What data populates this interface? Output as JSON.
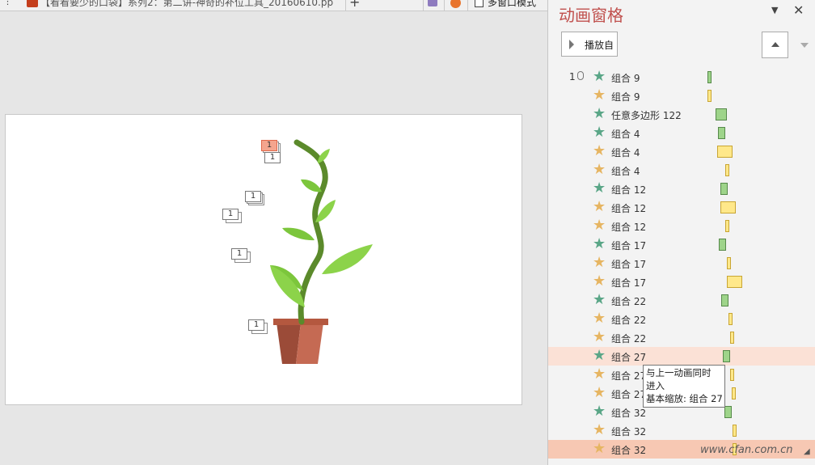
{
  "top_bar": {
    "overflow": "⋮",
    "document_tab": "【看看要少的口袋】系列2：第二讲-神奇的补位工具_20160610.pp",
    "new_tab": "+",
    "multiwindow_label": "多窗口模式"
  },
  "slide": {
    "tags": [
      "1",
      "1",
      "1",
      "1",
      "1",
      "1"
    ]
  },
  "pane": {
    "title": "动画窗格",
    "menu_glyph": "▼",
    "close_glyph": "✕",
    "play_label": "播放自",
    "colors": {
      "title": "#c0504d",
      "entrance_star": "#5aa687",
      "emphasis_star": "#e6b562",
      "green_bar": "#9ed48a",
      "yellow_bar": "#ffe88a"
    },
    "rows": [
      {
        "index": "1",
        "star": "green",
        "name": "组合 9",
        "bar": "green"
      },
      {
        "index": "",
        "star": "yellow",
        "name": "组合 9",
        "bar": "yellow"
      },
      {
        "index": "",
        "star": "green",
        "name": "任意多边形 122",
        "bar": "green"
      },
      {
        "index": "",
        "star": "green",
        "name": "组合 4",
        "bar": "green"
      },
      {
        "index": "",
        "star": "yellow",
        "name": "组合 4",
        "bar": "yellow"
      },
      {
        "index": "",
        "star": "yellow",
        "name": "组合 4",
        "bar": "yellow"
      },
      {
        "index": "",
        "star": "green",
        "name": "组合 12",
        "bar": "green"
      },
      {
        "index": "",
        "star": "yellow",
        "name": "组合 12",
        "bar": "yellow"
      },
      {
        "index": "",
        "star": "yellow",
        "name": "组合 12",
        "bar": "yellow"
      },
      {
        "index": "",
        "star": "green",
        "name": "组合 17",
        "bar": "green"
      },
      {
        "index": "",
        "star": "yellow",
        "name": "组合 17",
        "bar": "yellow"
      },
      {
        "index": "",
        "star": "yellow",
        "name": "组合 17",
        "bar": "yellow"
      },
      {
        "index": "",
        "star": "green",
        "name": "组合 22",
        "bar": "green"
      },
      {
        "index": "",
        "star": "yellow",
        "name": "组合 22",
        "bar": "yellow"
      },
      {
        "index": "",
        "star": "yellow",
        "name": "组合 22",
        "bar": "yellow"
      },
      {
        "index": "",
        "star": "green",
        "name": "组合 27",
        "bar": "green",
        "highlight": "hover"
      },
      {
        "index": "",
        "star": "yellow",
        "name": "组合 27",
        "bar": "yellow"
      },
      {
        "index": "",
        "star": "yellow",
        "name": "组合 27",
        "bar": "yellow"
      },
      {
        "index": "",
        "star": "green",
        "name": "组合 32",
        "bar": "green"
      },
      {
        "index": "",
        "star": "yellow",
        "name": "组合 32",
        "bar": "yellow"
      },
      {
        "index": "",
        "star": "yellow",
        "name": "组合 32",
        "bar": "yellow",
        "highlight": "selected"
      }
    ],
    "tooltip": {
      "line1": "与上一动画同时",
      "line2": "进入",
      "line3": "基本缩放: 组合 27"
    }
  },
  "watermark": "www.cfan.com.cn",
  "corner_glyph": "◢"
}
